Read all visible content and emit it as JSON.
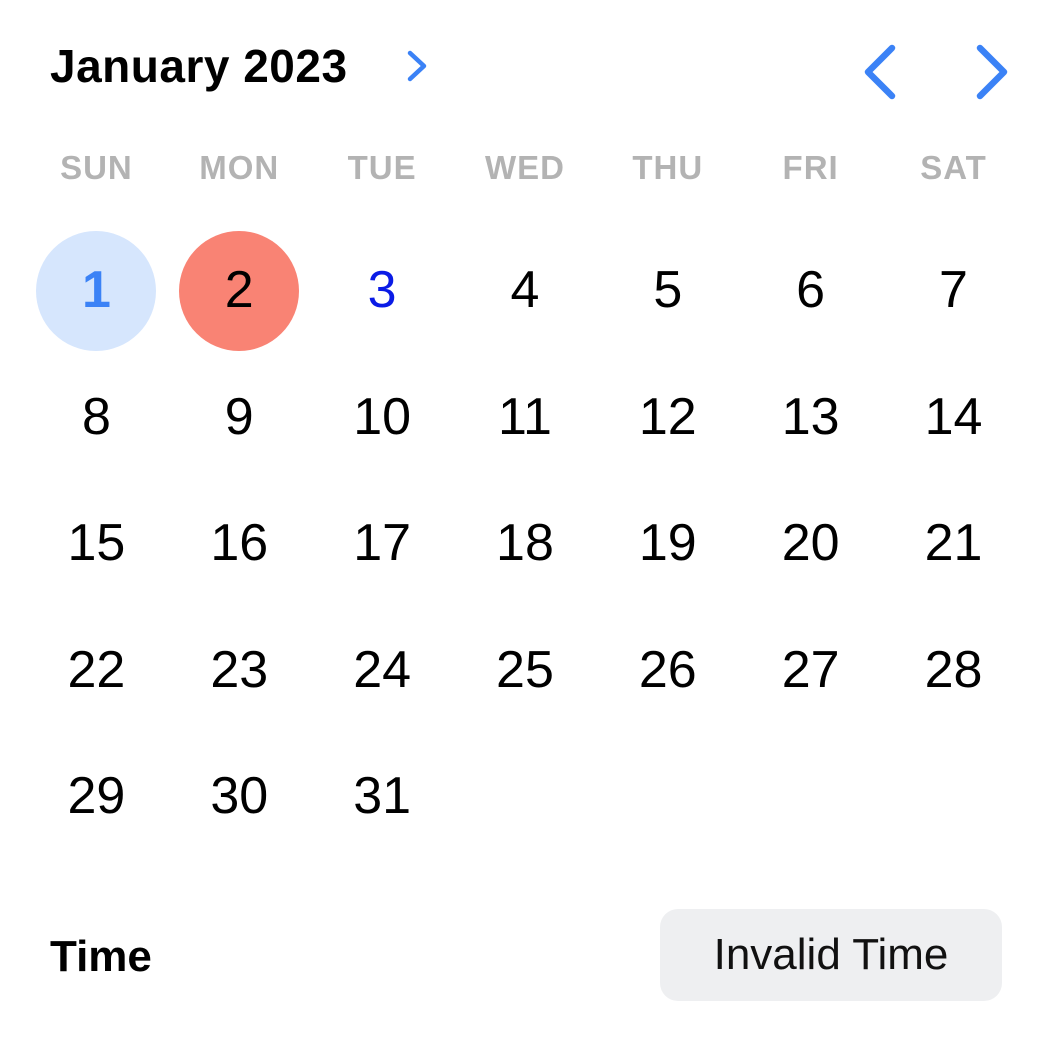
{
  "header": {
    "month_title": "January 2023"
  },
  "weekdays": [
    "SUN",
    "MON",
    "TUE",
    "WED",
    "THU",
    "FRI",
    "SAT"
  ],
  "days": [
    {
      "label": "1",
      "state": "selected"
    },
    {
      "label": "2",
      "state": "today"
    },
    {
      "label": "3",
      "state": "accent"
    },
    {
      "label": "4",
      "state": "normal"
    },
    {
      "label": "5",
      "state": "normal"
    },
    {
      "label": "6",
      "state": "normal"
    },
    {
      "label": "7",
      "state": "normal"
    },
    {
      "label": "8",
      "state": "normal"
    },
    {
      "label": "9",
      "state": "normal"
    },
    {
      "label": "10",
      "state": "normal"
    },
    {
      "label": "11",
      "state": "normal"
    },
    {
      "label": "12",
      "state": "normal"
    },
    {
      "label": "13",
      "state": "normal"
    },
    {
      "label": "14",
      "state": "normal"
    },
    {
      "label": "15",
      "state": "normal"
    },
    {
      "label": "16",
      "state": "normal"
    },
    {
      "label": "17",
      "state": "normal"
    },
    {
      "label": "18",
      "state": "normal"
    },
    {
      "label": "19",
      "state": "normal"
    },
    {
      "label": "20",
      "state": "normal"
    },
    {
      "label": "21",
      "state": "normal"
    },
    {
      "label": "22",
      "state": "normal"
    },
    {
      "label": "23",
      "state": "normal"
    },
    {
      "label": "24",
      "state": "normal"
    },
    {
      "label": "25",
      "state": "normal"
    },
    {
      "label": "26",
      "state": "normal"
    },
    {
      "label": "27",
      "state": "normal"
    },
    {
      "label": "28",
      "state": "normal"
    },
    {
      "label": "29",
      "state": "normal"
    },
    {
      "label": "30",
      "state": "normal"
    },
    {
      "label": "31",
      "state": "normal"
    }
  ],
  "time": {
    "label": "Time",
    "value": "Invalid Time"
  },
  "icons": {
    "month_expand": "chevron-right-icon",
    "prev_month": "chevron-left-icon",
    "next_month": "chevron-right-icon"
  },
  "colors": {
    "accent": "#3b82f6",
    "selected_bg": "#d6e6fd",
    "today_bg": "#f98374",
    "day_link": "#0a1be6",
    "weekday_text": "#b3b3b3",
    "pill_bg": "#eeeff1"
  }
}
